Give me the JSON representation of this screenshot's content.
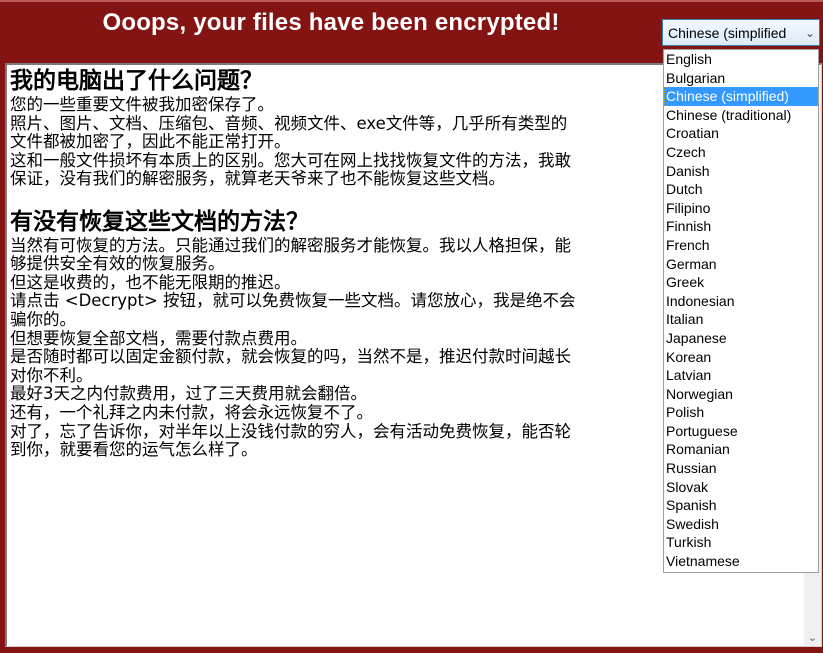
{
  "header": {
    "title": "Ooops, your files have been encrypted!"
  },
  "language_select": {
    "selected": "Chinese (simplified",
    "chevron_icon": "chevron-down-icon",
    "options": [
      "English",
      "Bulgarian",
      "Chinese (simplified)",
      "Chinese (traditional)",
      "Croatian",
      "Czech",
      "Danish",
      "Dutch",
      "Filipino",
      "Finnish",
      "French",
      "German",
      "Greek",
      "Indonesian",
      "Italian",
      "Japanese",
      "Korean",
      "Latvian",
      "Norwegian",
      "Polish",
      "Portuguese",
      "Romanian",
      "Russian",
      "Slovak",
      "Spanish",
      "Swedish",
      "Turkish",
      "Vietnamese"
    ],
    "selected_index": 2
  },
  "content": {
    "section1": {
      "heading": "我的电脑出了什么问题？",
      "lines": [
        "您的一些重要文件被我加密保存了。",
        "照片、图片、文档、压缩包、音频、视频文件、exe文件等，几乎所有类型的",
        "文件都被加密了，因此不能正常打开。",
        "这和一般文件损坏有本质上的区别。您大可在网上找找恢复文件的方法，我敢",
        "保证，没有我们的解密服务，就算老天爷来了也不能恢复这些文档。"
      ]
    },
    "section2": {
      "heading": "有没有恢复这些文档的方法？",
      "lines": [
        "当然有可恢复的方法。只能通过我们的解密服务才能恢复。我以人格担保，能",
        "够提供安全有效的恢复服务。",
        "但这是收费的，也不能无限期的推迟。",
        "请点击 <Decrypt> 按钮，就可以免费恢复一些文档。请您放心，我是绝不会",
        "骗你的。",
        "但想要恢复全部文档，需要付款点费用。",
        "是否随时都可以固定金额付款，就会恢复的吗，当然不是，推迟付款时间越长",
        "对你不利。",
        "最好3天之内付款费用，过了三天费用就会翻倍。",
        "还有，一个礼拜之内未付款，将会永远恢复不了。",
        "对了，忘了告诉你，对半年以上没钱付款的穷人，会有活动免费恢复，能否轮",
        "到你，就要看您的运气怎么样了。"
      ]
    }
  },
  "scrollbar": {
    "down_icon": "chevron-down-icon"
  }
}
